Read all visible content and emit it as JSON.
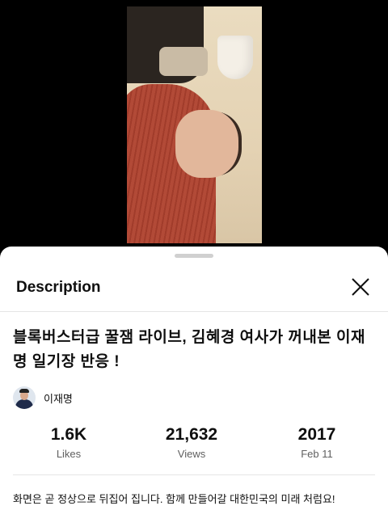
{
  "sheet": {
    "title": "Description",
    "close_icon": "close-icon"
  },
  "video": {
    "title": "블록버스터급 꿀잼 라이브, 김혜경 여사가 꺼내본 이재명 일기장 반응 !",
    "channel_name": "이재명",
    "description": "화면은 곧 정상으로 뒤집어 집니다. 함께 만들어갈 대한민국의 미래 처럼요!"
  },
  "stats": {
    "likes": {
      "value": "1.6K",
      "label": "Likes"
    },
    "views": {
      "value": "21,632",
      "label": "Views"
    },
    "date": {
      "value": "2017",
      "label": "Feb 11"
    }
  }
}
